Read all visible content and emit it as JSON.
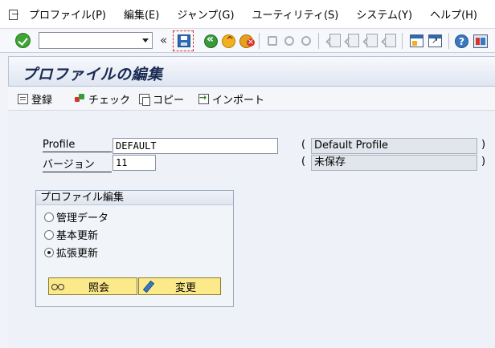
{
  "menu": {
    "items": [
      "プロファイル(P)",
      "編集(E)",
      "ジャンプ(G)",
      "ユーティリティ(S)",
      "システム(Y)",
      "ヘルプ(H)"
    ]
  },
  "toolbar": {
    "command_value": "",
    "collapse_glyph": "«",
    "help_glyph": "?"
  },
  "title": "プロファイルの編集",
  "app_toolbar": {
    "create_label": "登録",
    "check_label": "チェック",
    "copy_label": "コピー",
    "import_label": "インポート"
  },
  "form": {
    "profile_label": "Profile",
    "profile_value": "DEFAULT",
    "profile_desc": "Default Profile",
    "version_label": "バージョン",
    "version_value": "11",
    "version_desc": "未保存",
    "paren_open": "(",
    "paren_close": ")"
  },
  "group": {
    "title": "プロファイル編集",
    "options": [
      "管理データ",
      "基本更新",
      "拡張更新"
    ],
    "selected_index": 2,
    "display_label": "照会",
    "change_label": "変更"
  },
  "colors": {
    "accent": "#1b2a52",
    "button_yellow": "#fbe98a",
    "ok_green": "#3fa435"
  }
}
